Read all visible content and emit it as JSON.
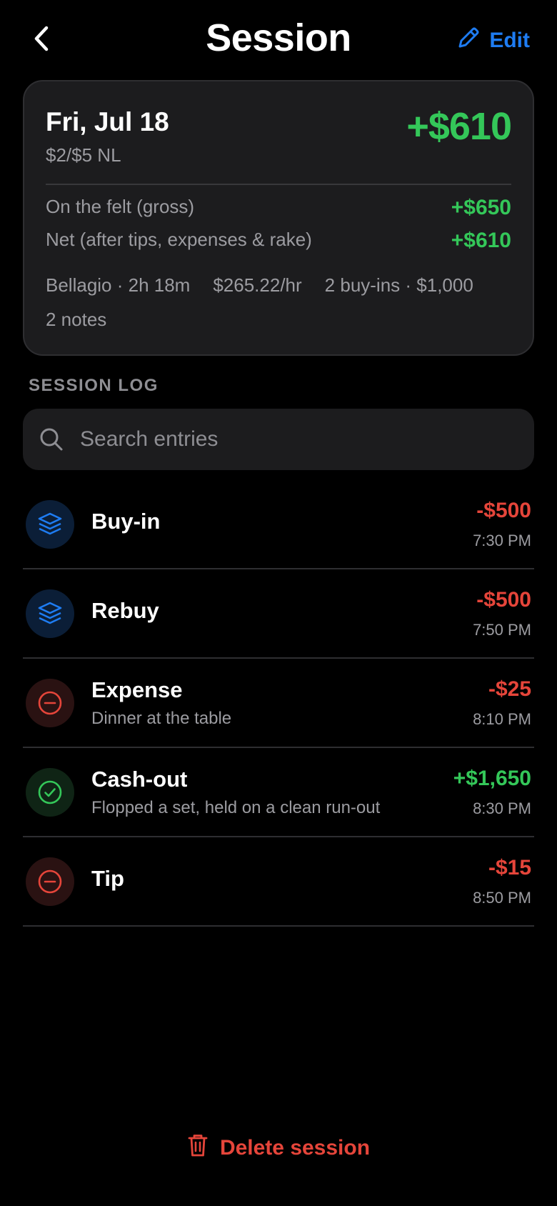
{
  "header": {
    "title": "Session",
    "edit_label": "Edit",
    "back_icon": "chevron-left-icon",
    "edit_icon": "pencil-icon"
  },
  "summary": {
    "date": "Fri, Jul 18",
    "stakes": "$2/$5 NL",
    "total": "+$610",
    "gross_label": "On the felt (gross)",
    "gross_value": "+$650",
    "net_label": "Net (after tips, expenses & rake)",
    "net_value": "+$610",
    "meta": {
      "venue_duration": "Bellagio · 2h 18m",
      "hourly": "$265.22/hr",
      "buyins": "2 buy-ins · $1,000"
    },
    "notes": "2 notes"
  },
  "log": {
    "section_label": "SESSION LOG",
    "search_placeholder": "Search entries",
    "items": [
      {
        "title": "Buy-in",
        "subtitle": "",
        "amount": "-$500",
        "time": "7:30 PM",
        "icon": "stack-icon",
        "tone": "negative"
      },
      {
        "title": "Rebuy",
        "subtitle": "",
        "amount": "-$500",
        "time": "7:50 PM",
        "icon": "stack-icon",
        "tone": "negative"
      },
      {
        "title": "Expense",
        "subtitle": "Dinner at the table",
        "amount": "-$25",
        "time": "8:10 PM",
        "icon": "minus-circle-icon",
        "tone": "negative"
      },
      {
        "title": "Cash-out",
        "subtitle": "Flopped a set, held on a clean run-out",
        "amount": "+$1,650",
        "time": "8:30 PM",
        "icon": "check-circle-icon",
        "tone": "positive"
      },
      {
        "title": "Tip",
        "subtitle": "",
        "amount": "-$15",
        "time": "8:50 PM",
        "icon": "minus-circle-icon",
        "tone": "negative"
      }
    ]
  },
  "footer": {
    "delete_label": "Delete session",
    "delete_icon": "trash-icon"
  },
  "colors": {
    "accent_blue": "#1e7cf2",
    "positive_green": "#34c759",
    "negative_red": "#e5453a",
    "card_bg": "#1c1c1e"
  }
}
